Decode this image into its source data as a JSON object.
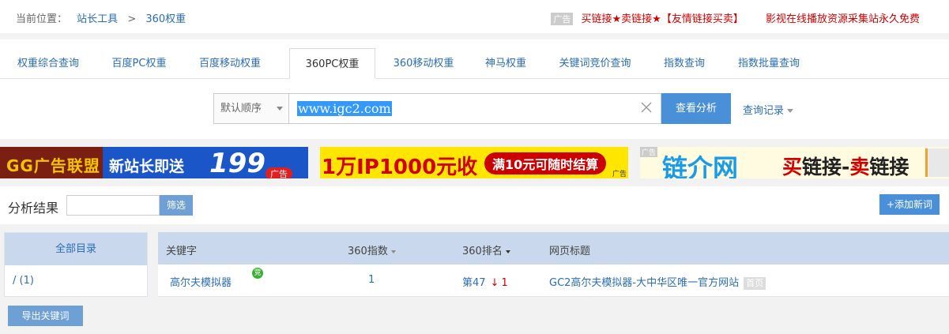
{
  "breadcrumb": {
    "prefix": "当前位置：",
    "home": "站长工具",
    "sep": ">",
    "current": "360权重"
  },
  "top_ads": {
    "tag": "广告",
    "link1": "买链接★卖链接★【友情链接买卖】",
    "link2": "影视在线播放资源采集站永久免费"
  },
  "tabs": [
    "权重综合查询",
    "百度PC权重",
    "百度移动权重",
    "360PC权重",
    "360移动权重",
    "神马权重",
    "关键词竞价查询",
    "指数查询",
    "指数批量查询"
  ],
  "active_tab": "360PC权重",
  "search": {
    "order_label": "默认顺序",
    "value": "www.igc2.com",
    "analyze_button": "查看分析",
    "history_link": "查询记录"
  },
  "banners": {
    "b1": {
      "brand": "GG广告联盟",
      "text": "新站长即送",
      "number": "199",
      "tag": "广告"
    },
    "b2": {
      "text": "1万IP1000元收",
      "pill": "满10元可随时结算",
      "tag": "广告"
    },
    "b3": {
      "tag": "广告",
      "logo": "链介网",
      "buy": "买",
      "buy_rest": "链接-",
      "sell": "卖",
      "sell_rest": "链接"
    }
  },
  "results": {
    "label": "分析结果",
    "filter_button": "筛选",
    "add_button": "+添加新词",
    "export_button": "导出关键词"
  },
  "directory": {
    "header": "全部目录",
    "row": "/  (1)"
  },
  "table": {
    "columns": {
      "keyword": "关键字",
      "index": "360指数",
      "rank": "360排名",
      "title": "网页标题"
    },
    "rows": [
      {
        "keyword": "高尔夫模拟器",
        "badge": "竞",
        "index": "1",
        "rank": "第47",
        "change": "1",
        "title": "GC2高尔夫模拟器-大中华区唯一官方网站",
        "title_tag": "首页"
      }
    ]
  },
  "colors": {
    "link": "#2a6db7",
    "primary": "#4a90d9",
    "header_bg": "#c9d8ec",
    "ad_red": "#d40000"
  }
}
